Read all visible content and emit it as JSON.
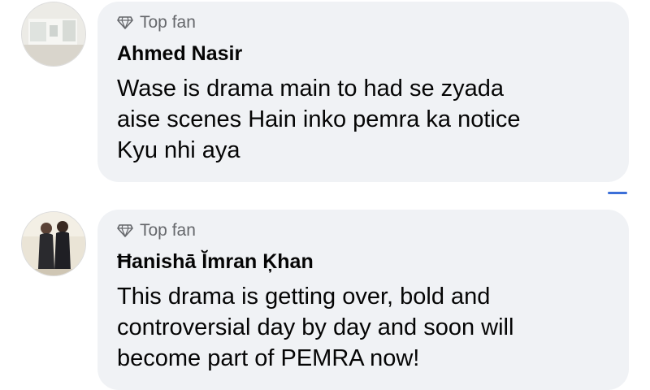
{
  "comments": [
    {
      "badge": "Top fan",
      "badge_icon": "diamond-icon",
      "author": "Ahmed Nasir",
      "lines": [
        "Wase is drama main to had se zyada",
        "aise scenes Hain inko pemra ka notice",
        "Kyu nhi aya"
      ]
    },
    {
      "badge": "Top fan",
      "badge_icon": "diamond-icon",
      "author": "Ħanishā Ĭmran Ķhan",
      "lines": [
        "This drama is getting over, bold and",
        "controversial day by day and soon will",
        "become part of PEMRA now!"
      ]
    }
  ],
  "colors": {
    "bubble": "#f0f2f5",
    "text": "#050505",
    "secondary": "#65676b"
  }
}
